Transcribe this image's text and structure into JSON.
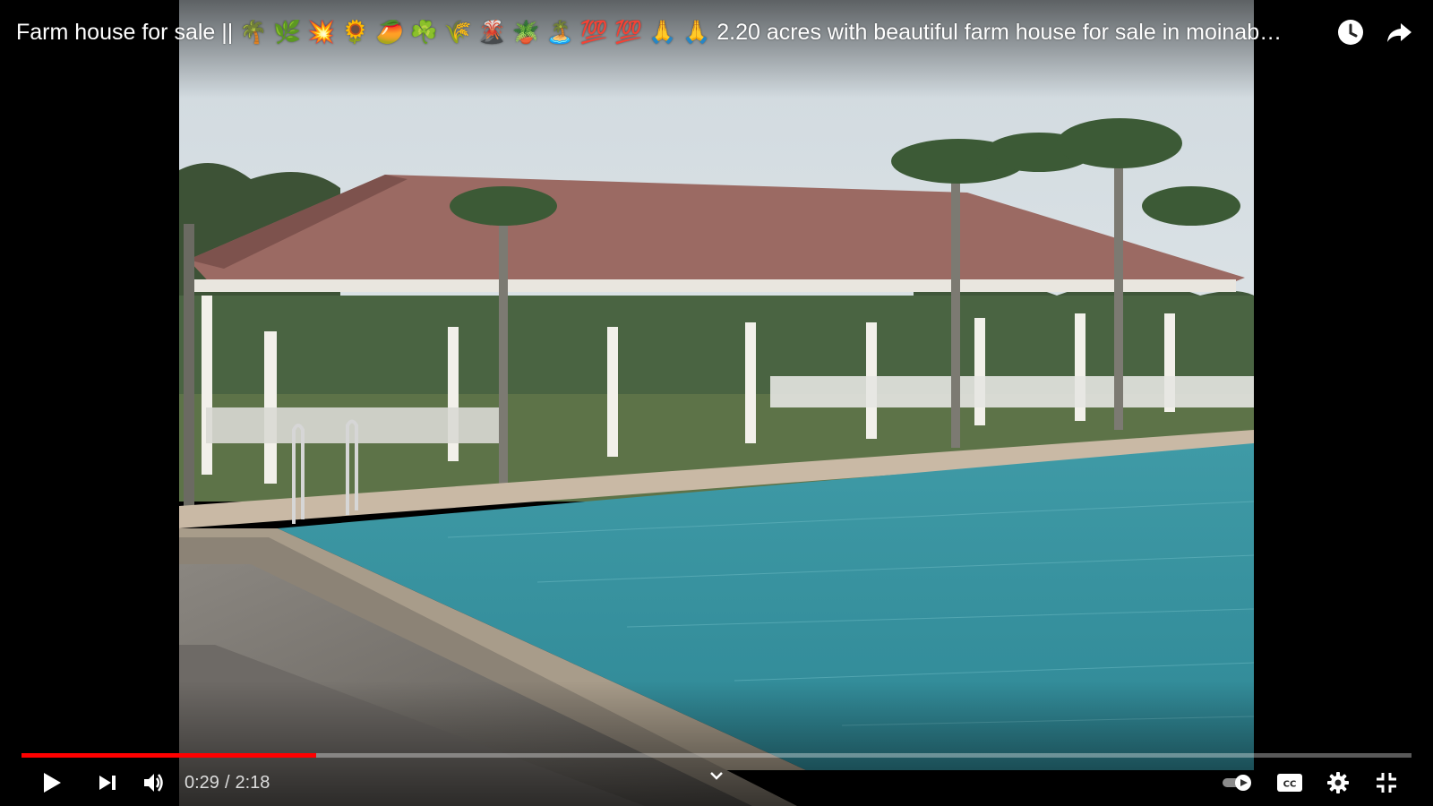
{
  "video": {
    "title": "Farm house for sale || 🌴 🌿 💥 🌻 🥭 ☘️ 🌾 🌋 🪴 🏝️ 💯 💯 🙏 🙏 2.20 acres with beautiful farm house for sale in moinab…"
  },
  "player": {
    "current_time": "0:29",
    "separator": "/",
    "duration": "2:18",
    "progress_played": 0.212,
    "progress_loaded": 0.212,
    "autoplay_on": true
  },
  "icons": {
    "watch_later": "clock-icon",
    "share": "share-arrow-icon",
    "play": "play-icon",
    "next": "skip-next-icon",
    "volume": "volume-icon",
    "chapters": "chevron-down-icon",
    "autoplay": "autoplay-toggle-icon",
    "captions": "cc-icon",
    "settings": "gear-icon",
    "fullscreen": "fullscreen-exit-icon"
  },
  "colors": {
    "progress_played": "#ff0000",
    "accent": "#ffffff"
  }
}
